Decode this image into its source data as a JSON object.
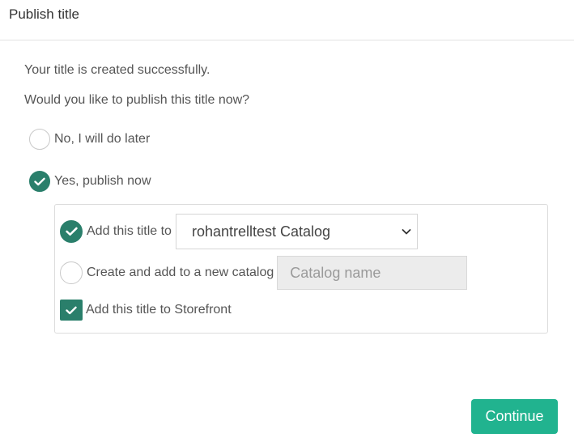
{
  "dialog": {
    "title": "Publish title"
  },
  "messages": {
    "success": "Your title is created successfully.",
    "question": "Would you like to publish this title now?"
  },
  "publish_options": {
    "no_label": "No, I will do later",
    "yes_label": "Yes, publish now",
    "selected": "yes"
  },
  "catalog": {
    "add_existing_label": "Add this title to",
    "selected_catalog": "rohantrelltest Catalog",
    "add_existing_selected": true,
    "create_new_label": "Create and add to a new catalog",
    "catalog_name_value": "",
    "catalog_name_placeholder": "Catalog name",
    "create_new_selected": false,
    "storefront_label": "Add this title to Storefront",
    "storefront_checked": true
  },
  "actions": {
    "continue_label": "Continue"
  },
  "colors": {
    "accent": "#2a7f6b",
    "button": "#21b38f"
  },
  "icons": {
    "radio_check": "check-icon",
    "select_chevron": "chevron-down-icon",
    "checkbox_check": "check-icon"
  }
}
